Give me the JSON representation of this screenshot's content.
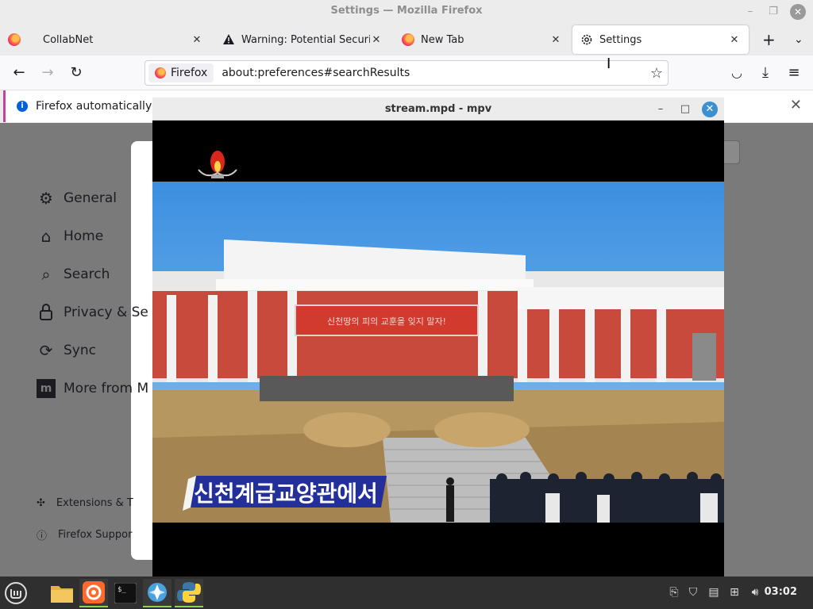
{
  "window": {
    "title": "Settings — Mozilla Firefox"
  },
  "tabs": [
    {
      "label": "CollabNet",
      "icon": "firefox-icon"
    },
    {
      "label": "Warning: Potential Security",
      "icon": "warning-icon"
    },
    {
      "label": "New Tab",
      "icon": "firefox-icon"
    },
    {
      "label": "Settings",
      "icon": "gear-icon",
      "active": true
    }
  ],
  "navbar": {
    "identity_label": "Firefox",
    "url": "about:preferences#searchResults"
  },
  "notification": {
    "text": "Firefox automatically ser"
  },
  "sidebar": {
    "items": [
      {
        "label": "General",
        "icon": "gear-icon"
      },
      {
        "label": "Home",
        "icon": "home-icon"
      },
      {
        "label": "Search",
        "icon": "search-icon"
      },
      {
        "label": "Privacy & Se",
        "icon": "lock-icon"
      },
      {
        "label": "Sync",
        "icon": "sync-icon"
      },
      {
        "label": "More from M",
        "icon": "mozilla-icon"
      }
    ],
    "bottom": [
      {
        "label": "Extensions & T",
        "icon": "puzzle-icon"
      },
      {
        "label": "Firefox Suppor",
        "icon": "help-icon"
      }
    ]
  },
  "mpv": {
    "title": "stream.mpd - mpv",
    "banner_text": "신천계급교양관에서",
    "sign_text": "신천땅의 피의 교훈을 잊지 말자!"
  },
  "taskbar": {
    "clock": "03:02",
    "apps": [
      "menu-icon",
      "files-icon",
      "firefox-icon",
      "terminal-icon",
      "settings-app-icon",
      "python-icon"
    ]
  },
  "colors": {
    "accent": "#3d8fd1",
    "notify_border": "#c142a0",
    "taskbar": "#2f2f2f",
    "sky": "#4a9ee8"
  }
}
